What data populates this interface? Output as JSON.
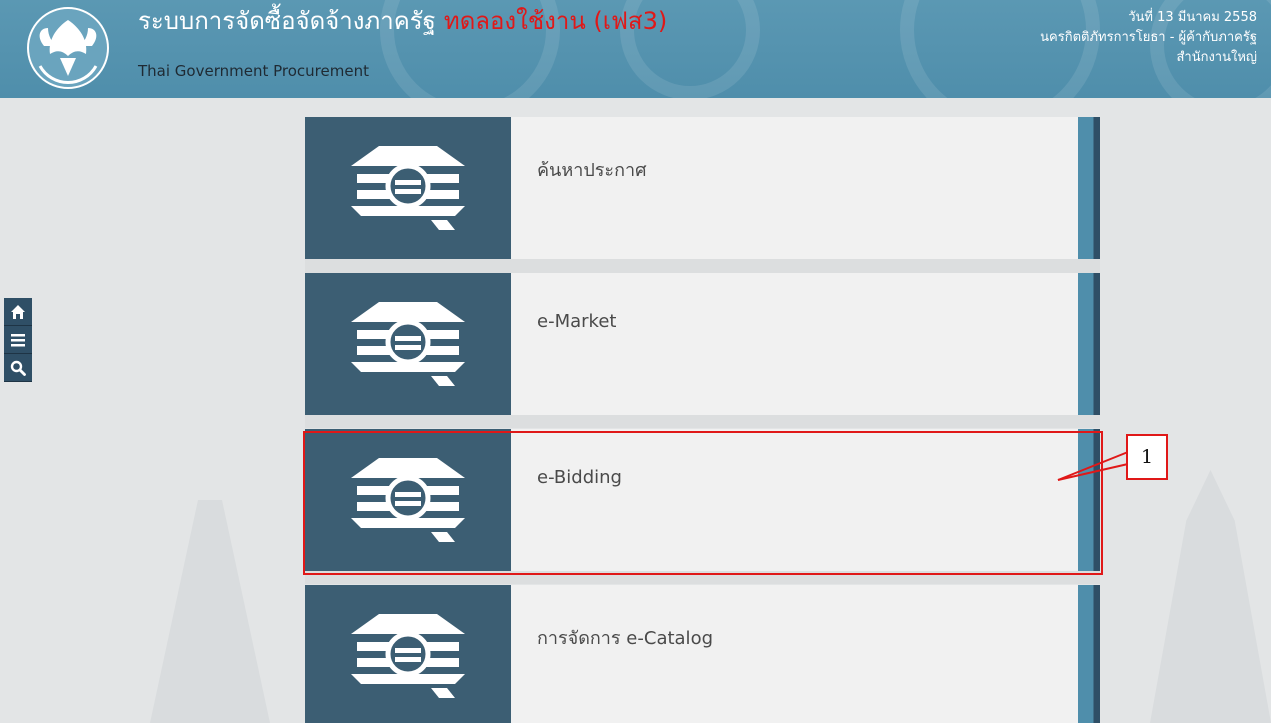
{
  "header": {
    "title": "ระบบการจัดซื้อจัดจ้างภาครัฐ",
    "trial": "ทดลองใช้งาน (เฟส3)",
    "subtitle": "Thai Government Procurement",
    "date": "วันที่ 13 มีนาคม 2558",
    "user": "นครกิตติภัทรการโยธา - ผู้ค้ากับภาครัฐ",
    "office": "สำนักงานใหญ่"
  },
  "sidenav": {
    "icons": [
      "home-icon",
      "menu-icon",
      "search-icon"
    ]
  },
  "menu": {
    "items": [
      {
        "label": "ค้นหาประกาศ"
      },
      {
        "label": "e-Market"
      },
      {
        "label": "e-Bidding"
      },
      {
        "label": "การจัดการ e-Catalog"
      }
    ]
  },
  "annotation": {
    "callout_number": "1"
  },
  "colors": {
    "header": "#4f8eab",
    "icon_box": "#3c5e73",
    "card": "#f1f1f1",
    "highlight": "#e01818"
  }
}
